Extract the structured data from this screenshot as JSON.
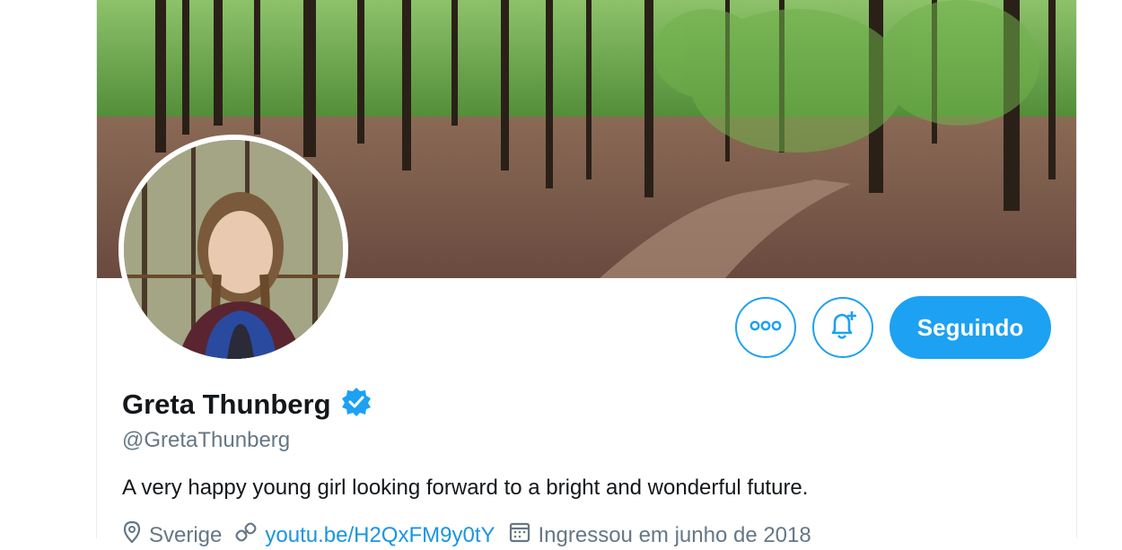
{
  "profile": {
    "display_name": "Greta Thunberg",
    "handle": "@GretaThunberg",
    "bio": "A very happy young girl looking forward to a bright and wonderful future.",
    "location": "Sverige",
    "website": "youtu.be/H2QxFM9y0tY",
    "joined": "Ingressou em junho de 2018"
  },
  "actions": {
    "follow_label": "Seguindo",
    "more_icon": "more-horizontal-icon",
    "notify_icon": "bell-plus-icon"
  },
  "colors": {
    "accent": "#1da1f2",
    "link": "#1b95e0",
    "secondary_text": "#657786",
    "primary_text": "#14171a"
  }
}
